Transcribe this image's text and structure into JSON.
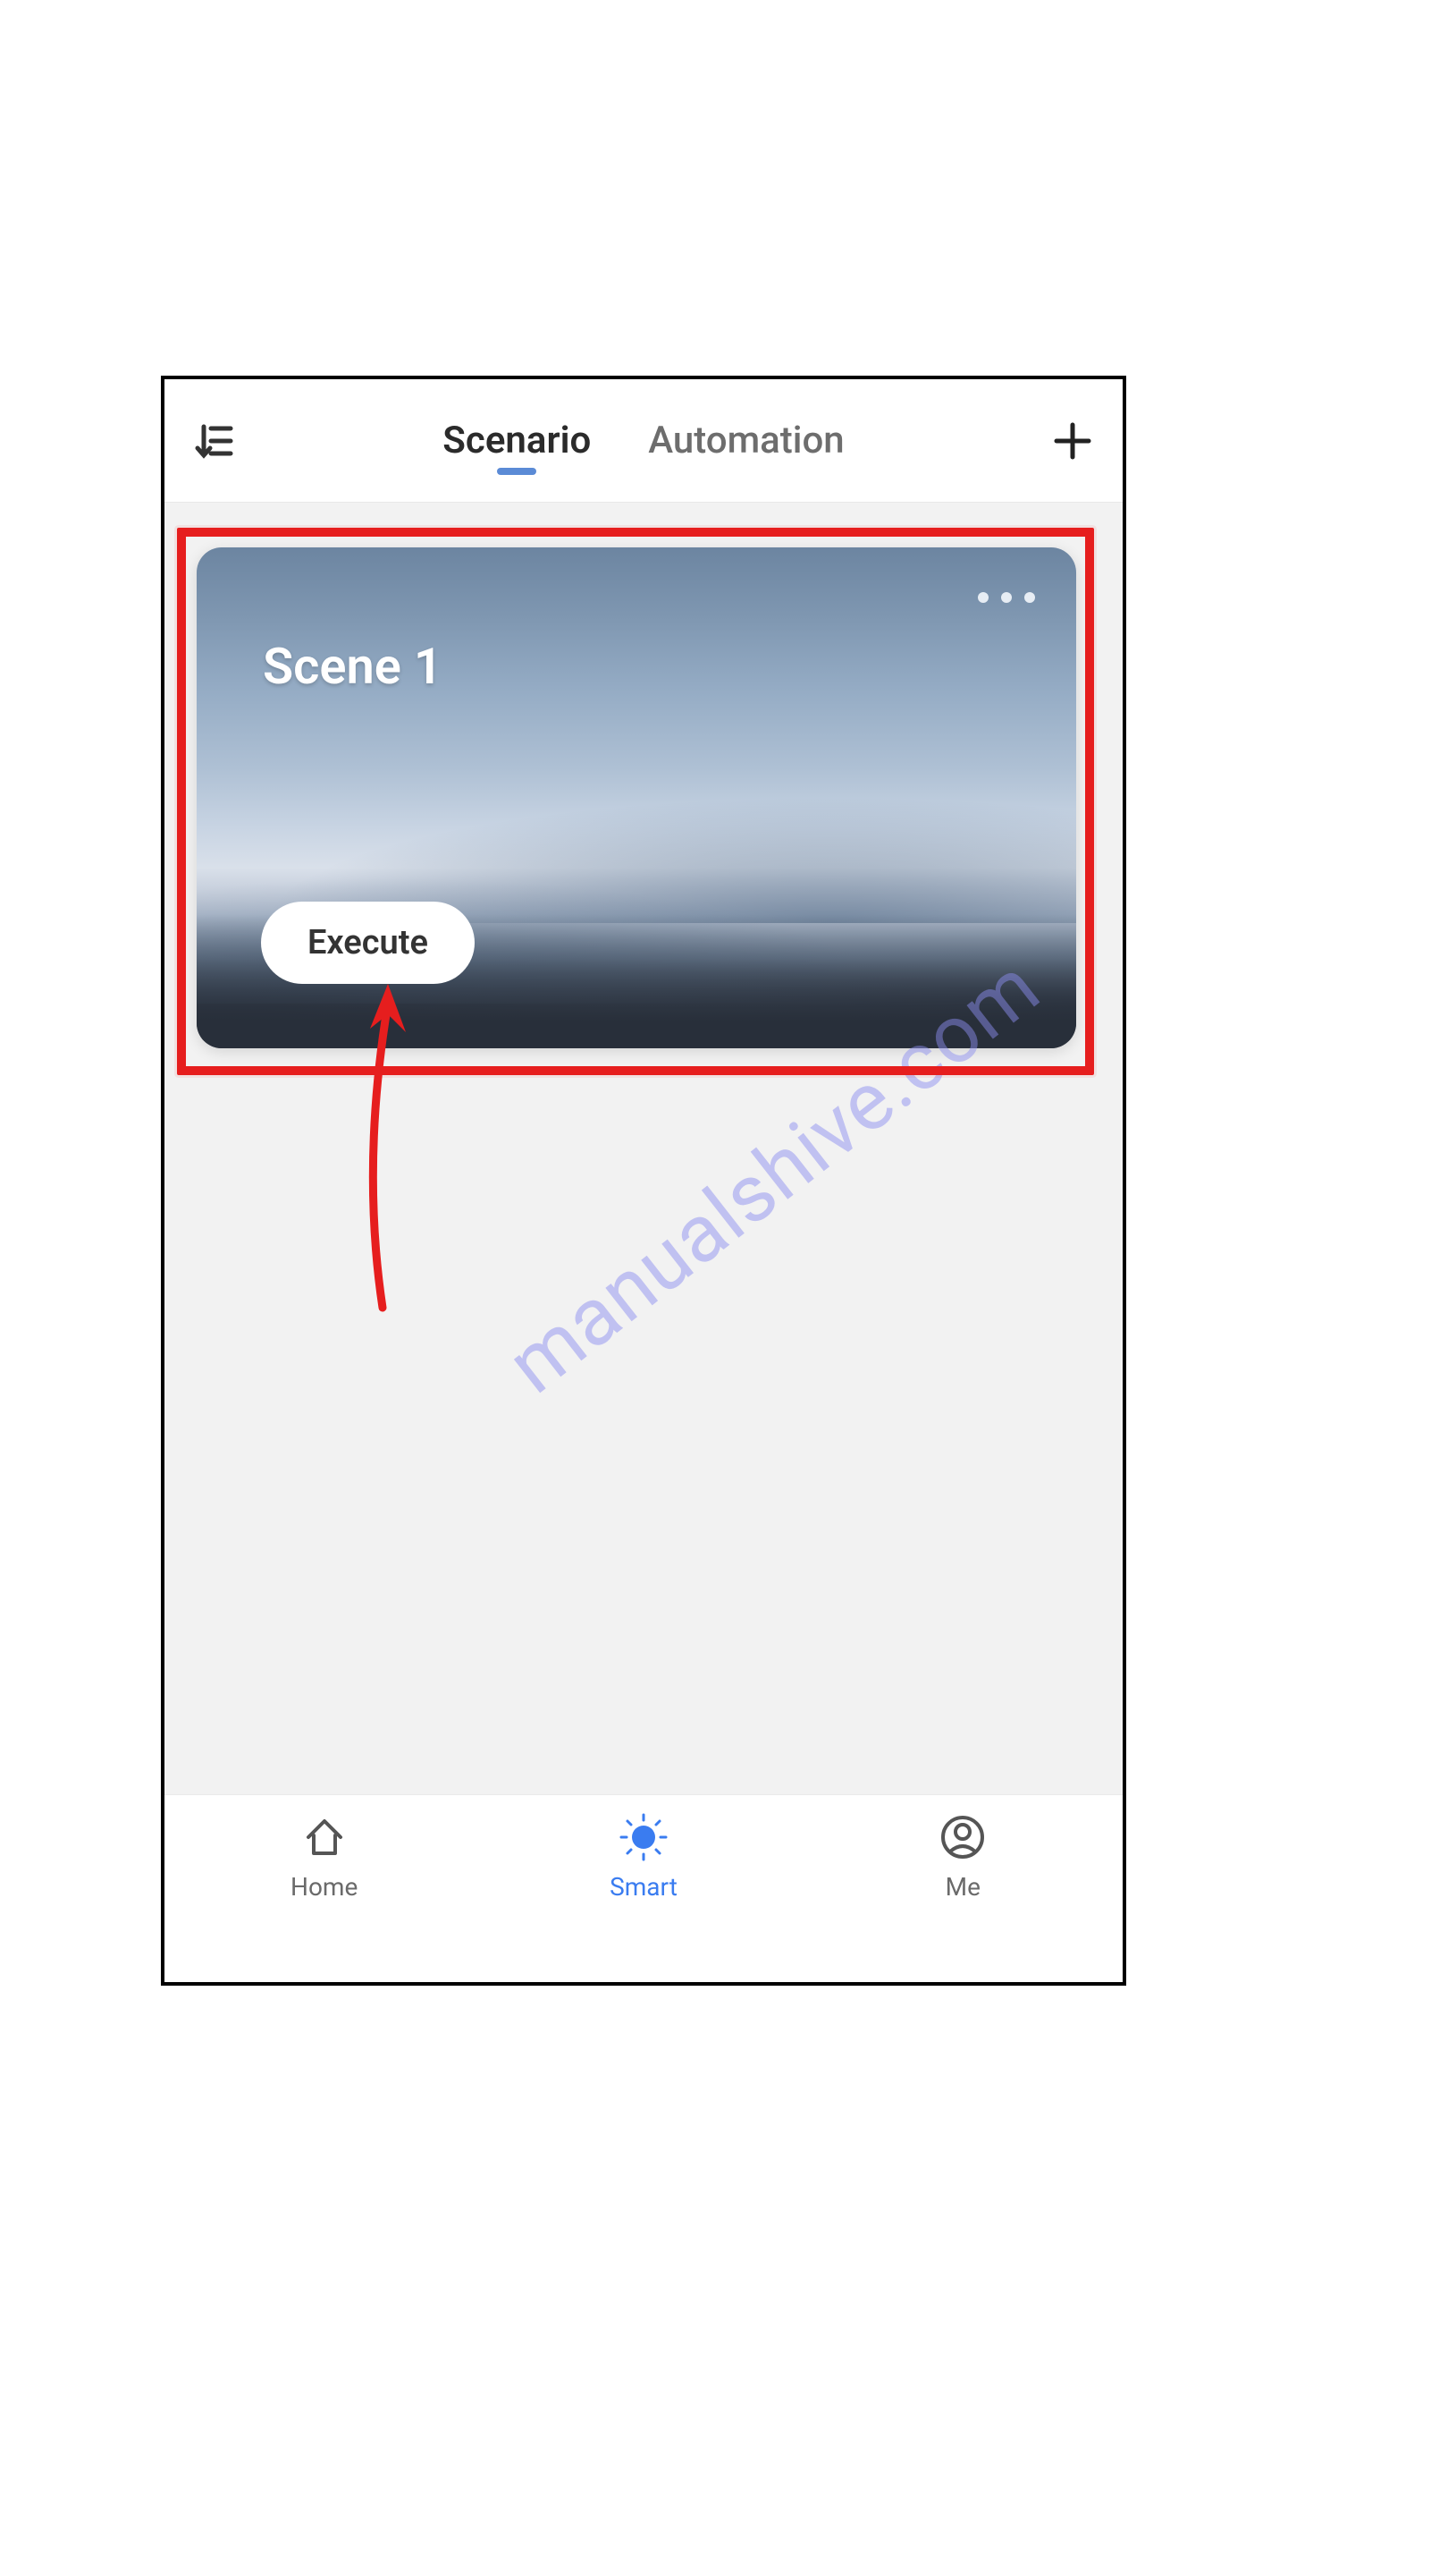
{
  "header": {
    "tabs": [
      {
        "label": "Scenario",
        "active": true
      },
      {
        "label": "Automation",
        "active": false
      }
    ]
  },
  "scene_card": {
    "title": "Scene 1",
    "execute_label": "Execute"
  },
  "watermark": "manualshive.com",
  "annotation": {
    "highlight_target": "scene-card",
    "arrow_target": "execute-button",
    "highlight_color": "#e61e1e"
  },
  "bottom_nav": {
    "items": [
      {
        "label": "Home",
        "icon": "home-icon",
        "active": false
      },
      {
        "label": "Smart",
        "icon": "sun-icon",
        "active": true
      },
      {
        "label": "Me",
        "icon": "user-icon",
        "active": false
      }
    ]
  }
}
